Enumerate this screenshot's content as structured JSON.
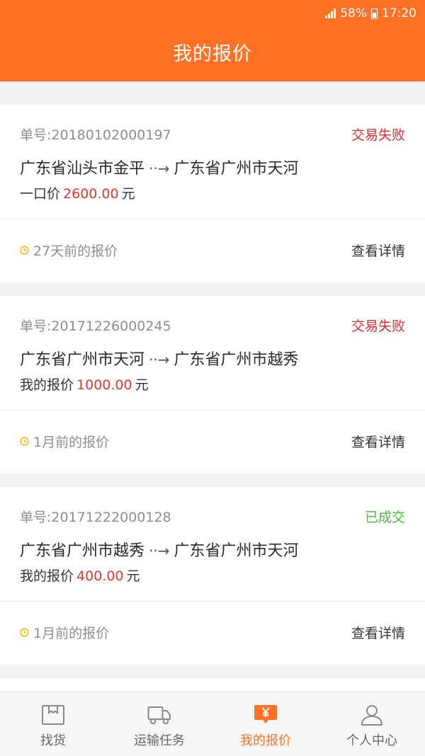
{
  "status_bar": {
    "battery": "58%",
    "time": "17:20"
  },
  "header": {
    "title": "我的报价"
  },
  "quotes": [
    {
      "order_no": "单号:20180102000197",
      "status": "交易失败",
      "status_color": "#e02d2d",
      "from": "广东省汕头市金平",
      "arrow": "··→",
      "to": "广东省广州市天河",
      "price_label": "一口价",
      "price": "2600.00",
      "unit": "元",
      "time": "27天前的报价",
      "detail": "查看详情"
    },
    {
      "order_no": "单号:20171226000245",
      "status": "交易失败",
      "status_color": "#e02d2d",
      "from": "广东省广州市天河",
      "arrow": "··→",
      "to": "广东省广州市越秀",
      "price_label": "我的报价",
      "price": "1000.00",
      "unit": "元",
      "time": "1月前的报价",
      "detail": "查看详情"
    },
    {
      "order_no": "单号:20171222000128",
      "status": "已成交",
      "status_color": "#4cb944",
      "from": "广东省广州市越秀",
      "arrow": "··→",
      "to": "广东省广州市天河",
      "price_label": "我的报价",
      "price": "400.00",
      "unit": "元",
      "time": "1月前的报价",
      "detail": "查看详情"
    }
  ],
  "tabs": [
    {
      "label": "找货",
      "icon": "box-icon",
      "active": false
    },
    {
      "label": "运输任务",
      "icon": "truck-icon",
      "active": false
    },
    {
      "label": "我的报价",
      "icon": "yen-bubble-icon",
      "active": true
    },
    {
      "label": "个人中心",
      "icon": "person-icon",
      "active": false
    }
  ],
  "colors": {
    "brand": "#ff7226",
    "price": "#e23b2b",
    "clock": "#f5b800"
  }
}
